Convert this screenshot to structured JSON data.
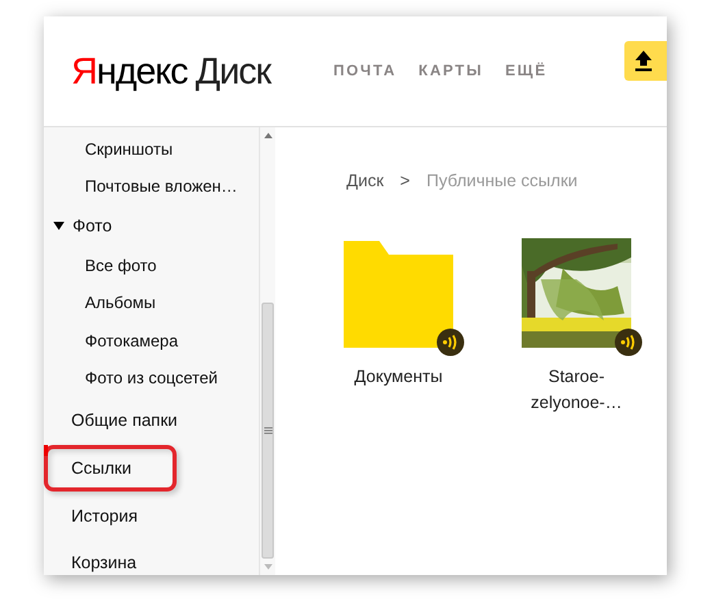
{
  "header": {
    "logo": "Яндекс",
    "product": "Диск",
    "nav": [
      "ПОЧТА",
      "КАРТЫ",
      "ЕЩЁ"
    ]
  },
  "sidebar": {
    "items": [
      {
        "label": "Скриншоты",
        "kind": "sub",
        "selected": false,
        "highlighted": false
      },
      {
        "label": "Почтовые вложен…",
        "kind": "sub",
        "selected": false,
        "highlighted": false
      },
      {
        "label": "Фото",
        "kind": "group",
        "expanded": true,
        "selected": false,
        "highlighted": false,
        "children": [
          {
            "label": "Все фото",
            "kind": "sub",
            "selected": false,
            "highlighted": false
          },
          {
            "label": "Альбомы",
            "kind": "sub",
            "selected": false,
            "highlighted": false
          },
          {
            "label": "Фотокамера",
            "kind": "sub",
            "selected": false,
            "highlighted": false
          },
          {
            "label": "Фото из соцсетей",
            "kind": "sub",
            "selected": false,
            "highlighted": false
          }
        ]
      },
      {
        "label": "Общие папки",
        "kind": "top",
        "selected": false,
        "highlighted": false
      },
      {
        "label": "Ссылки",
        "kind": "top",
        "selected": true,
        "highlighted": true
      },
      {
        "label": "История",
        "kind": "top",
        "selected": false,
        "highlighted": false
      },
      {
        "label": "Корзина",
        "kind": "top",
        "selected": false,
        "highlighted": false
      }
    ]
  },
  "breadcrumb": {
    "items": [
      "Диск",
      "Публичные ссылки"
    ],
    "separator": ">"
  },
  "files": [
    {
      "name": "Документы",
      "kind": "folder",
      "shared": true
    },
    {
      "name": "Staroe-zelyonoe-…",
      "kind": "picture",
      "shared": true
    }
  ]
}
